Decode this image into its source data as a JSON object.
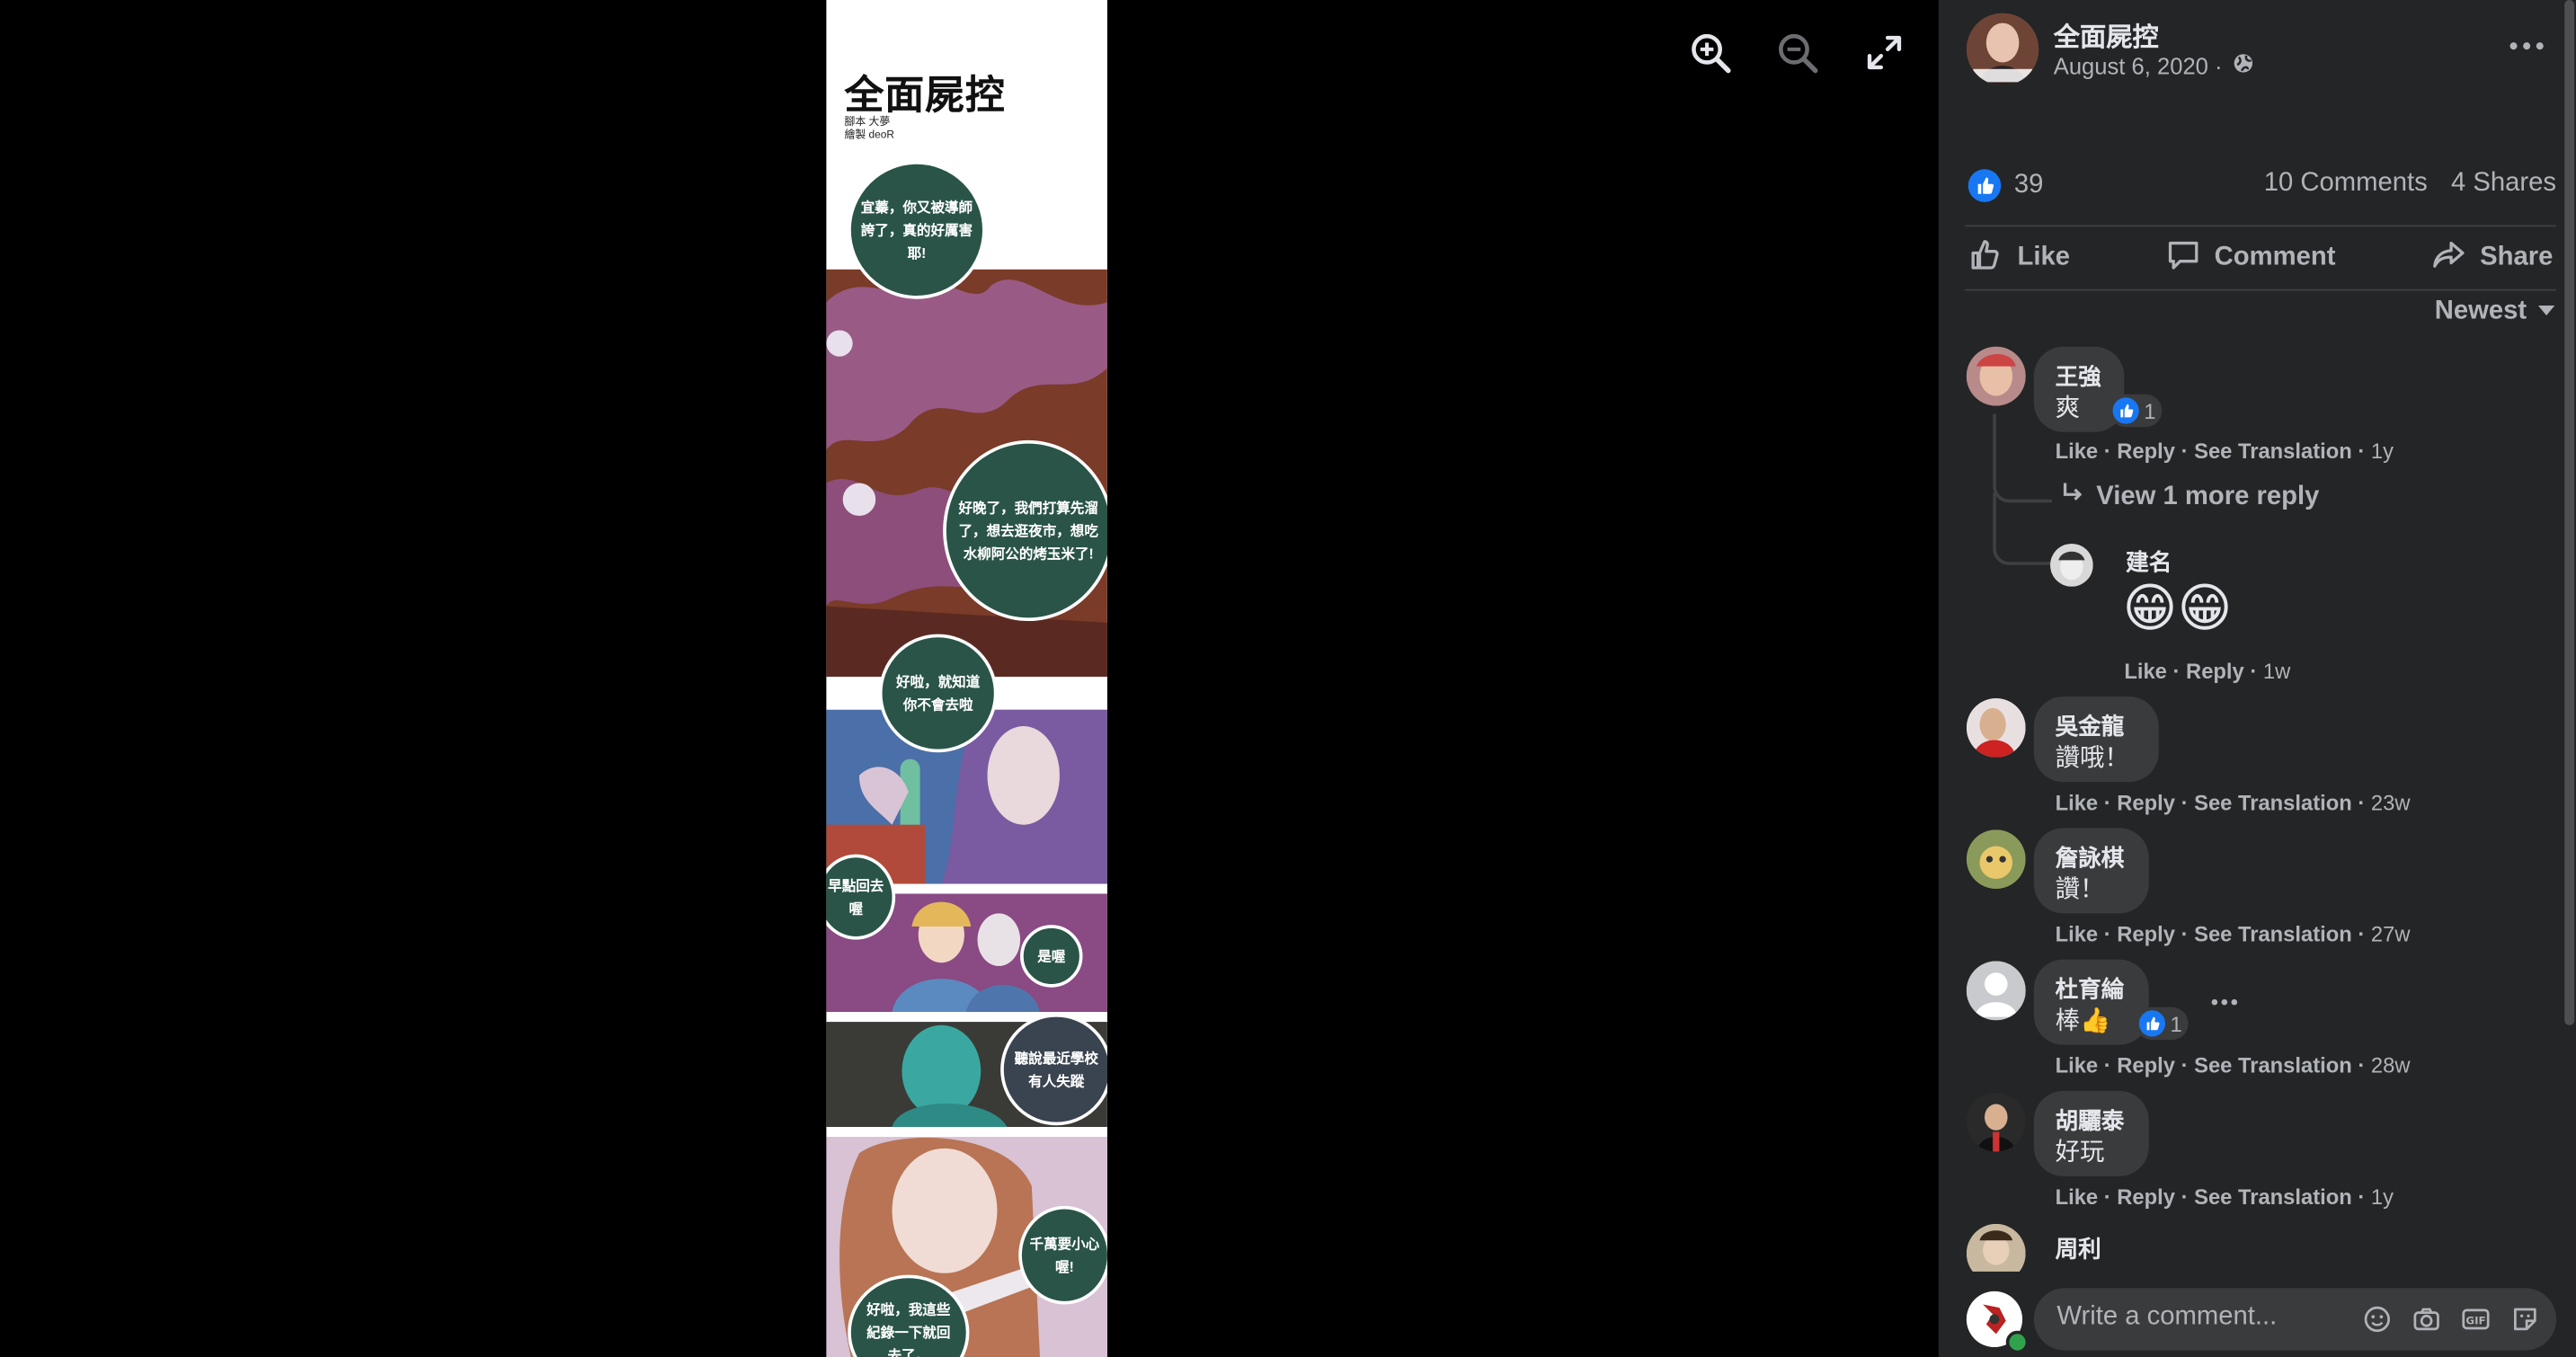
{
  "viewer": {
    "comic": {
      "title": "全面屍控",
      "credit_script": "腳本 大夢",
      "credit_art": "繪製 deoR",
      "bubbles": [
        "宜蓁，你又被導師誇了，真的好厲害耶!",
        "好晚了，我們打算先溜了，想去逛夜市，想吃水柳阿公的烤玉米了!",
        "好啦，就知道你不會去啦",
        "早點回去喔",
        "是喔",
        "聽說最近學校有人失蹤",
        "千萬要小心喔!",
        "好啦，我這些紀錄一下就回去了。"
      ]
    },
    "tools": [
      "zoom-in-icon",
      "zoom-out-icon",
      "fullscreen-icon"
    ]
  },
  "post": {
    "page_name": "全面屍控",
    "date": "August 6, 2020 ·",
    "like_count": "39",
    "comments_count": "10 Comments",
    "shares_count": "4 Shares",
    "actions": {
      "like": "Like",
      "comment": "Comment",
      "share": "Share"
    },
    "sort": "Newest",
    "accent": "#1877f2"
  },
  "comments": [
    {
      "name": "王強",
      "text": "爽",
      "reactions": "1",
      "like": "Like",
      "reply": "Reply",
      "translate": "See Translation",
      "time": "1y"
    },
    {
      "name": "吳金龍",
      "text": "讚哦！",
      "like": "Like",
      "reply": "Reply",
      "translate": "See Translation",
      "time": "23w"
    },
    {
      "name": "詹詠棋",
      "text": "讚！",
      "like": "Like",
      "reply": "Reply",
      "translate": "See Translation",
      "time": "27w"
    },
    {
      "name": "杜育綸",
      "text": "棒👍",
      "reactions": "1",
      "like": "Like",
      "reply": "Reply",
      "translate": "See Translation",
      "time": "28w"
    },
    {
      "name": "胡驪泰",
      "text": "好玩",
      "like": "Like",
      "reply": "Reply",
      "translate": "See Translation",
      "time": "1y"
    },
    {
      "name": "周利"
    }
  ],
  "reply_thread": {
    "view_more": "View 1 more reply",
    "reply": {
      "name": "建名",
      "text": "😁😁",
      "like": "Like",
      "reply": "Reply",
      "time": "1w"
    }
  },
  "composer": {
    "placeholder": "Write a comment..."
  }
}
